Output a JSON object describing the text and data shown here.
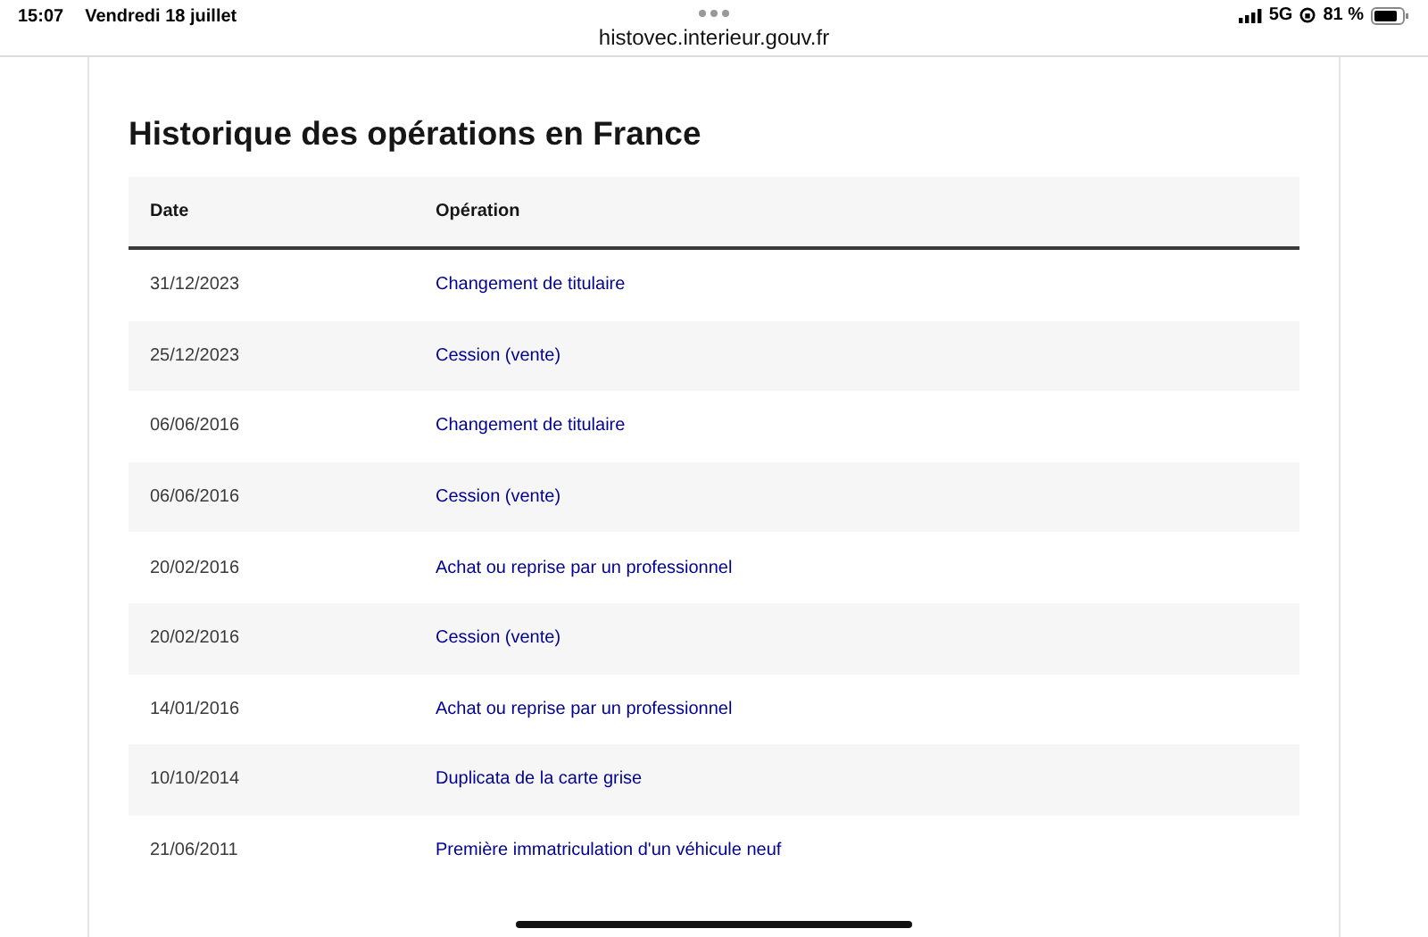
{
  "status_bar": {
    "time": "15:07",
    "date": "Vendredi 18 juillet",
    "network": "5G",
    "battery": "81 %"
  },
  "address_bar": {
    "url": "histovec.interieur.gouv.fr"
  },
  "title": "Historique des opérations en France",
  "table": {
    "columns": [
      "Date",
      "Opération"
    ],
    "rows": [
      {
        "date": "31/12/2023",
        "operation": "Changement de titulaire"
      },
      {
        "date": "25/12/2023",
        "operation": "Cession (vente)"
      },
      {
        "date": "06/06/2016",
        "operation": "Changement de titulaire"
      },
      {
        "date": "06/06/2016",
        "operation": "Cession (vente)"
      },
      {
        "date": "20/02/2016",
        "operation": "Achat ou reprise par un professionnel"
      },
      {
        "date": "20/02/2016",
        "operation": "Cession (vente)"
      },
      {
        "date": "14/01/2016",
        "operation": "Achat ou reprise par un professionnel"
      },
      {
        "date": "10/10/2014",
        "operation": "Duplicata de la carte grise"
      },
      {
        "date": "21/06/2011",
        "operation": "Première immatriculation d'un véhicule neuf"
      }
    ]
  }
}
